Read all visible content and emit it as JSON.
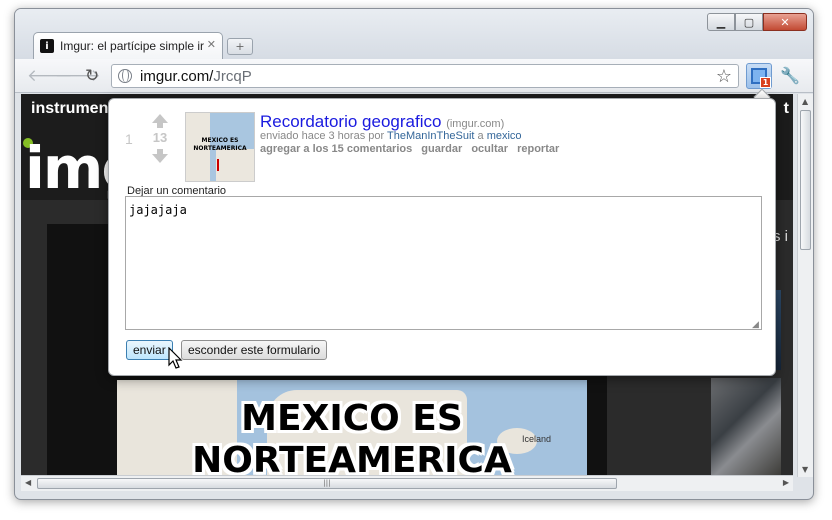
{
  "browser": {
    "tab_title": "Imgur: el partícipe simple ir",
    "tab_favicon": "i",
    "url_host": "imgur.com/",
    "url_path": "JrcqP",
    "extension_badge": "1"
  },
  "site": {
    "header_left": "instrument",
    "header_right": "t",
    "logo": "img",
    "side_text": "s i",
    "image_caption_line1": "MEXICO ES",
    "image_caption_line2": "NORTEAMERICA",
    "map_city": "Iceland"
  },
  "popup": {
    "rank": "1",
    "score": "13",
    "thumb_text": "MEXICO ES NORTEAMERICA",
    "title": "Recordatorio geografico",
    "domain": "(imgur.com)",
    "meta_prefix": "enviado hace 3 horas por",
    "author": "TheManInTheSuit",
    "meta_mid": "a",
    "subreddit": "mexico",
    "actions": [
      "agregar a los 15 comentarios",
      "guardar",
      "ocultar",
      "reportar"
    ],
    "comment_label": "Dejar un comentario",
    "comment_value": "jajajaja",
    "send_button": "enviar",
    "hide_button": "esconder este formulario"
  },
  "icons": [
    "back-arrow-icon",
    "forward-arrow-icon",
    "reload-icon",
    "globe-icon",
    "star-icon",
    "extension-icon",
    "wrench-icon",
    "upvote-icon",
    "downvote-icon",
    "cursor-icon"
  ]
}
